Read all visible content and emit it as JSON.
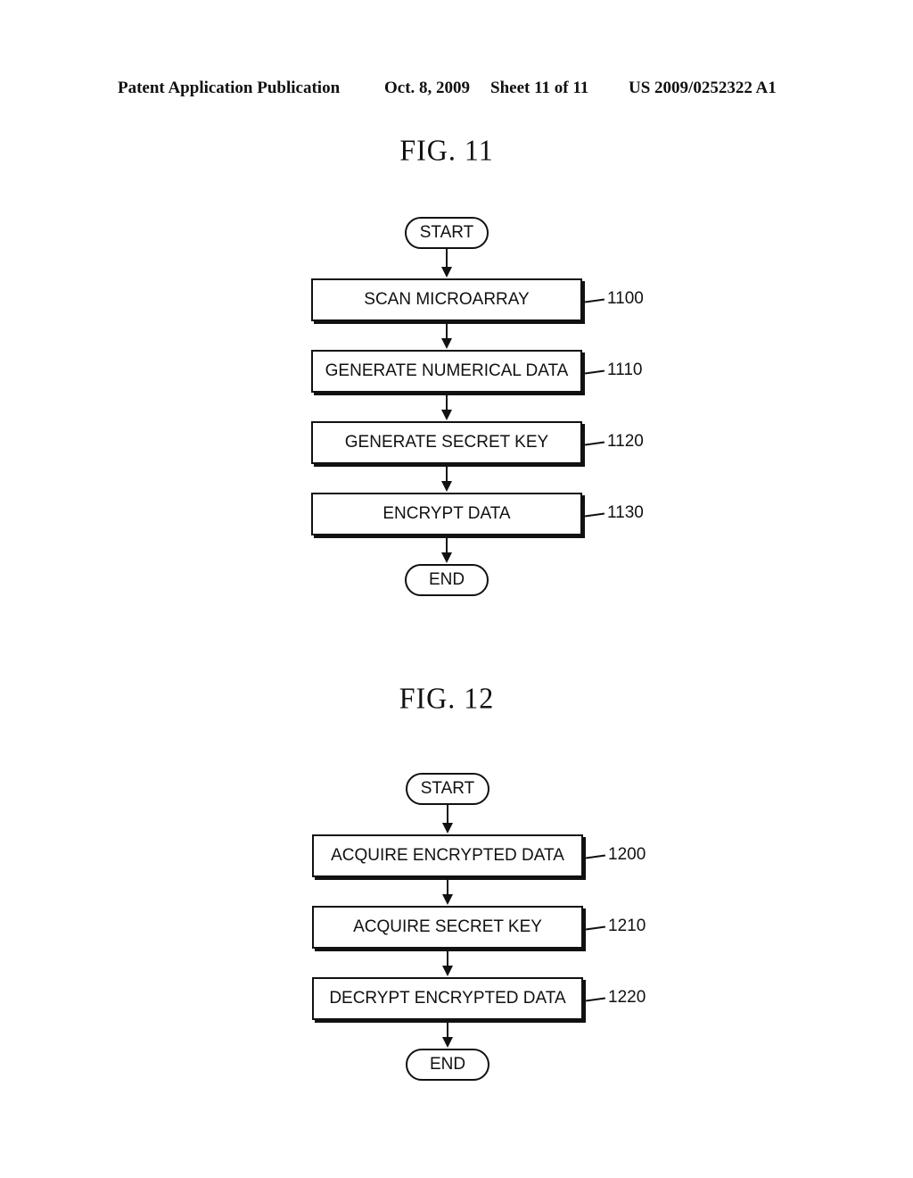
{
  "header": {
    "publication": "Patent Application Publication",
    "date": "Oct. 8, 2009",
    "sheet": "Sheet 11 of 11",
    "number": "US 2009/0252322 A1"
  },
  "figures": [
    {
      "title": "FIG. 11",
      "start": "START",
      "end": "END",
      "steps": [
        {
          "label": "SCAN MICROARRAY",
          "ref": "1100"
        },
        {
          "label": "GENERATE NUMERICAL DATA",
          "ref": "1110"
        },
        {
          "label": "GENERATE SECRET KEY",
          "ref": "1120"
        },
        {
          "label": "ENCRYPT DATA",
          "ref": "1130"
        }
      ]
    },
    {
      "title": "FIG. 12",
      "start": "START",
      "end": "END",
      "steps": [
        {
          "label": "ACQUIRE ENCRYPTED DATA",
          "ref": "1200"
        },
        {
          "label": "ACQUIRE SECRET KEY",
          "ref": "1210"
        },
        {
          "label": "DECRYPT ENCRYPTED DATA",
          "ref": "1220"
        }
      ]
    }
  ]
}
